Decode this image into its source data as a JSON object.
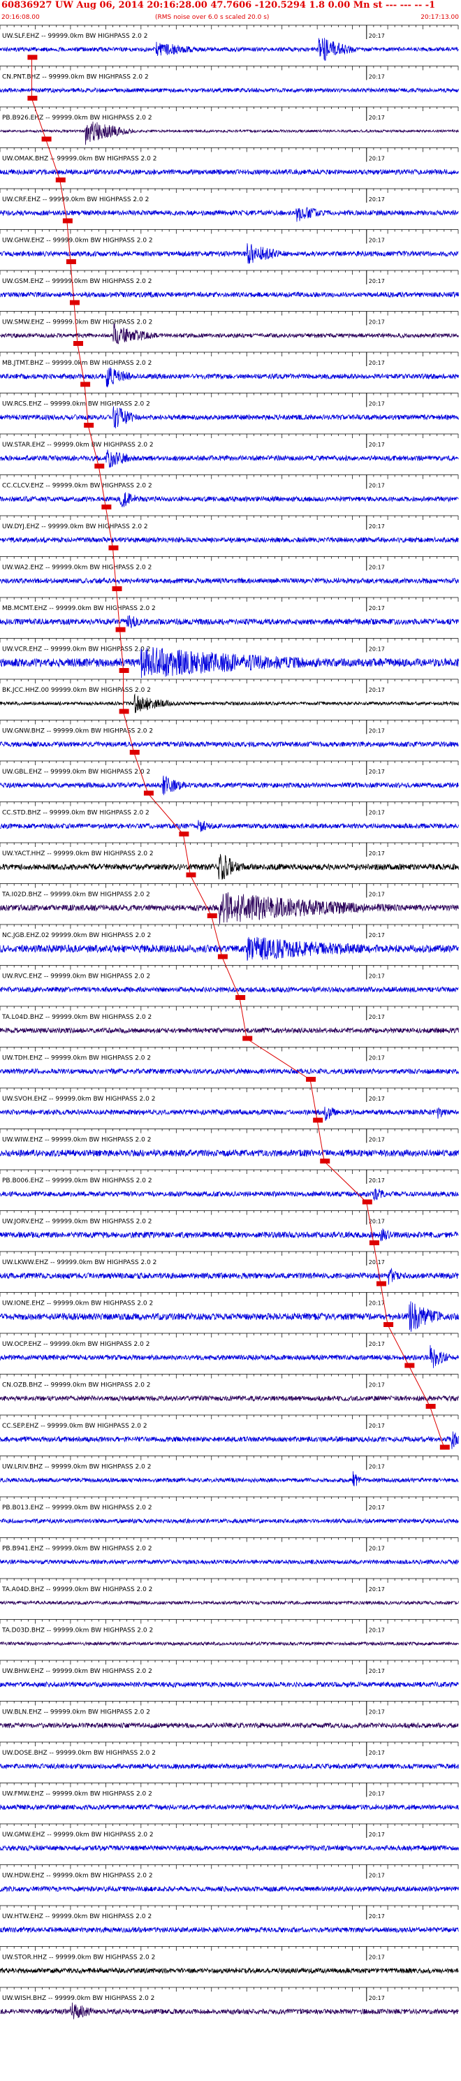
{
  "header": {
    "title": "60836927 UW Aug 06, 2014 20:16:28.00   47.7606 -120.5294  1.8 0.00 Mn st --- --- -- -1",
    "start_time": "20:16:08.00",
    "noise_note": "(RMS noise over 6.0 s scaled 20.0 s)",
    "end_time": "20:17:13.00"
  },
  "colors": {
    "trace_blue": "#0000dd",
    "trace_black": "#000000",
    "trace_purple": "#2a005a",
    "pick_red": "#dd0000",
    "minute_mark": "#000000"
  },
  "chart_data": {
    "type": "line",
    "xlim": [
      "20:16:08.00",
      "20:17:13.00"
    ],
    "minute_label": "20:17",
    "minute_mark_time_s": 52,
    "duration_s": 65,
    "traces": [
      {
        "label": "UW.SLF.EHZ -- 99999.0km BW  HIGHPASS  2.0  2",
        "pick_s": 4.5,
        "color": "blue",
        "amp": 0.25,
        "events": [
          [
            22,
            10,
            0.5
          ],
          [
            45,
            7,
            0.9
          ]
        ]
      },
      {
        "label": "CN.PNT.BHZ -- 99999.0km BW  HIGHPASS  2.0  2",
        "pick_s": 4.5,
        "color": "blue",
        "amp": 0.25,
        "events": []
      },
      {
        "label": "PB.B926.EHZ -- 99999.0km BW  HIGHPASS  2.0  2",
        "pick_s": 6.5,
        "color": "purple",
        "amp": 0.15,
        "events": [
          [
            12,
            8,
            0.9
          ]
        ]
      },
      {
        "label": "UW.OMAK.BHZ -- 99999.0km BW  HIGHPASS  2.0  2",
        "pick_s": 8.5,
        "color": "blue",
        "amp": 0.3,
        "events": []
      },
      {
        "label": "UW.CRF.EHZ -- 99999.0km BW  HIGHPASS  2.0  2",
        "pick_s": 9.5,
        "color": "blue",
        "amp": 0.3,
        "events": [
          [
            42,
            6,
            0.6
          ]
        ]
      },
      {
        "label": "UW.GHW.EHZ -- 99999.0km BW  HIGHPASS  2.0  2",
        "pick_s": 10,
        "color": "blue",
        "amp": 0.3,
        "events": [
          [
            35,
            8,
            0.7
          ]
        ]
      },
      {
        "label": "UW.GSM.EHZ -- 99999.0km BW  HIGHPASS  2.0  2",
        "pick_s": 10.5,
        "color": "blue",
        "amp": 0.3,
        "events": []
      },
      {
        "label": "UW.SMW.EHZ -- 99999.0km BW  HIGHPASS  2.0  2",
        "pick_s": 11,
        "color": "purple",
        "amp": 0.25,
        "events": [
          [
            16,
            8,
            0.8
          ]
        ]
      },
      {
        "label": "MB.JTMT.BHZ -- 99999.0km BW  HIGHPASS  2.0  2",
        "pick_s": 12,
        "color": "blue",
        "amp": 0.3,
        "events": [
          [
            15,
            6,
            0.7
          ]
        ]
      },
      {
        "label": "UW.RCS.EHZ -- 99999.0km BW  HIGHPASS  2.0  2",
        "pick_s": 12.5,
        "color": "blue",
        "amp": 0.3,
        "events": [
          [
            16,
            5,
            0.8
          ]
        ]
      },
      {
        "label": "UW.STAR.EHZ -- 99999.0km BW  HIGHPASS  2.0  2",
        "pick_s": 14,
        "color": "blue",
        "amp": 0.3,
        "events": [
          [
            15,
            6,
            0.7
          ]
        ]
      },
      {
        "label": "CC.CLCV.EHZ -- 99999.0km BW  HIGHPASS  2.0  2",
        "pick_s": 15,
        "color": "blue",
        "amp": 0.3,
        "events": [
          [
            17,
            5,
            0.6
          ]
        ]
      },
      {
        "label": "UW.DYJ.EHZ -- 99999.0km BW  HIGHPASS  2.0  2",
        "pick_s": 16,
        "color": "blue",
        "amp": 0.3,
        "events": []
      },
      {
        "label": "UW.WA2.EHZ -- 99999.0km BW  HIGHPASS  2.0  2",
        "pick_s": 16.5,
        "color": "blue",
        "amp": 0.3,
        "events": []
      },
      {
        "label": "MB.MCMT.EHZ -- 99999.0km BW  HIGHPASS  2.0  2",
        "pick_s": 17,
        "color": "blue",
        "amp": 0.35,
        "events": [
          [
            18,
            4,
            0.5
          ]
        ]
      },
      {
        "label": "UW.VCR.EHZ -- 99999.0km BW  HIGHPASS  2.0  2",
        "pick_s": 17.5,
        "color": "blue",
        "amp": 0.5,
        "events": [
          [
            20,
            40,
            1.0
          ]
        ]
      },
      {
        "label": "BK.JCC.HHZ.00 99999.0km BW  HIGHPASS  2.0  2",
        "pick_s": 17.5,
        "color": "black",
        "amp": 0.2,
        "events": [
          [
            19,
            8,
            0.6
          ]
        ]
      },
      {
        "label": "UW.GNW.BHZ -- 99999.0km BW  HIGHPASS  2.0  2",
        "pick_s": 19,
        "color": "blue",
        "amp": 0.3,
        "events": []
      },
      {
        "label": "UW.GBL.EHZ -- 99999.0km BW  HIGHPASS  2.0  2",
        "pick_s": 21,
        "color": "blue",
        "amp": 0.3,
        "events": [
          [
            23,
            5,
            0.7
          ]
        ]
      },
      {
        "label": "CC.STD.BHZ -- 99999.0km BW  HIGHPASS  2.0  2",
        "pick_s": 26,
        "color": "blue",
        "amp": 0.3,
        "events": [
          [
            28,
            4,
            0.5
          ]
        ]
      },
      {
        "label": "UW.YACT.HHZ -- 99999.0km BW  HIGHPASS  2.0  2",
        "pick_s": 27,
        "color": "black",
        "amp": 0.35,
        "events": [
          [
            31,
            5,
            1.0
          ]
        ]
      },
      {
        "label": "TA.I02D.BHZ -- 99999.0km BW  HIGHPASS  2.0  2",
        "pick_s": 30,
        "color": "purple",
        "amp": 0.35,
        "events": [
          [
            31,
            34,
            1.0
          ]
        ]
      },
      {
        "label": "NC.JGB.EHZ.02 99999.0km BW  HIGHPASS  2.0  2",
        "pick_s": 31.5,
        "color": "blue",
        "amp": 0.45,
        "events": [
          [
            35,
            30,
            0.8
          ]
        ]
      },
      {
        "label": "UW.RVC.EHZ -- 99999.0km BW  HIGHPASS  2.0  2",
        "pick_s": 34,
        "color": "blue",
        "amp": 0.3,
        "events": []
      },
      {
        "label": "TA.L04D.BHZ -- 99999.0km BW  HIGHPASS  2.0  2",
        "pick_s": 35,
        "color": "purple",
        "amp": 0.3,
        "events": []
      },
      {
        "label": "UW.TDH.EHZ -- 99999.0km BW  HIGHPASS  2.0  2",
        "pick_s": 44,
        "color": "blue",
        "amp": 0.3,
        "events": []
      },
      {
        "label": "UW.SVOH.EHZ -- 99999.0km BW  HIGHPASS  2.0  2",
        "pick_s": 45,
        "color": "blue",
        "amp": 0.3,
        "events": [
          [
            46,
            3,
            0.6
          ],
          [
            62,
            2,
            0.5
          ]
        ]
      },
      {
        "label": "UW.WIW.EHZ -- 99999.0km BW  HIGHPASS  2.0  2",
        "pick_s": 46,
        "color": "blue",
        "amp": 0.4,
        "events": []
      },
      {
        "label": "PB.B006.EHZ -- 99999.0km BW  HIGHPASS  2.0  2",
        "pick_s": 52,
        "color": "blue",
        "amp": 0.3,
        "events": [
          [
            53,
            3,
            0.5
          ]
        ]
      },
      {
        "label": "UW.JORV.EHZ -- 99999.0km BW  HIGHPASS  2.0  2",
        "pick_s": 53,
        "color": "blue",
        "amp": 0.35,
        "events": [
          [
            54,
            3,
            0.5
          ]
        ]
      },
      {
        "label": "UW.LKWW.EHZ -- 99999.0km BW  HIGHPASS  2.0  2",
        "pick_s": 54,
        "color": "blue",
        "amp": 0.35,
        "events": [
          [
            55,
            3,
            0.6
          ]
        ]
      },
      {
        "label": "UW.IONE.EHZ -- 99999.0km BW  HIGHPASS  2.0  2",
        "pick_s": 55,
        "color": "blue",
        "amp": 0.4,
        "events": [
          [
            58,
            7,
            1.0
          ]
        ]
      },
      {
        "label": "UW.OCP.EHZ -- 99999.0km BW  HIGHPASS  2.0  2",
        "pick_s": 58,
        "color": "blue",
        "amp": 0.3,
        "events": [
          [
            61,
            4,
            0.8
          ]
        ]
      },
      {
        "label": "CN.OZB.BHZ -- 99999.0km BW  HIGHPASS  2.0  2",
        "pick_s": 61,
        "color": "purple",
        "amp": 0.3,
        "events": []
      },
      {
        "label": "CC.SEP.EHZ -- 99999.0km BW  HIGHPASS  2.0  2",
        "pick_s": 63,
        "color": "blue",
        "amp": 0.3,
        "events": [
          [
            64,
            2,
            0.7
          ]
        ]
      },
      {
        "label": "UW.LRIV.BHZ -- 99999.0km BW  HIGHPASS  2.0  2",
        "pick_s": null,
        "color": "blue",
        "amp": 0.25,
        "events": [
          [
            50,
            2,
            0.6
          ]
        ]
      },
      {
        "label": "PB.B013.EHZ -- 99999.0km BW  HIGHPASS  2.0  2",
        "pick_s": null,
        "color": "blue",
        "amp": 0.25,
        "events": []
      },
      {
        "label": "PB.B941.EHZ -- 99999.0km BW  HIGHPASS  2.0  2",
        "pick_s": null,
        "color": "blue",
        "amp": 0.25,
        "events": []
      },
      {
        "label": "TA.A04D.BHZ -- 99999.0km BW  HIGHPASS  2.0  2",
        "pick_s": null,
        "color": "purple",
        "amp": 0.2,
        "events": []
      },
      {
        "label": "TA.D03D.BHZ -- 99999.0km BW  HIGHPASS  2.0  2",
        "pick_s": null,
        "color": "purple",
        "amp": 0.2,
        "events": []
      },
      {
        "label": "UW.BHW.EHZ -- 99999.0km BW  HIGHPASS  2.0  2",
        "pick_s": null,
        "color": "blue",
        "amp": 0.3,
        "events": []
      },
      {
        "label": "UW.BLN.EHZ -- 99999.0km BW  HIGHPASS  2.0  2",
        "pick_s": null,
        "color": "purple",
        "amp": 0.3,
        "events": []
      },
      {
        "label": "UW.DOSE.BHZ -- 99999.0km BW  HIGHPASS  2.0  2",
        "pick_s": null,
        "color": "blue",
        "amp": 0.3,
        "events": []
      },
      {
        "label": "UW.FMW.EHZ -- 99999.0km BW  HIGHPASS  2.0  2",
        "pick_s": null,
        "color": "blue",
        "amp": 0.3,
        "events": []
      },
      {
        "label": "UW.GMW.EHZ -- 99999.0km BW  HIGHPASS  2.0  2",
        "pick_s": null,
        "color": "blue",
        "amp": 0.3,
        "events": []
      },
      {
        "label": "UW.HDW.EHZ -- 99999.0km BW  HIGHPASS  2.0  2",
        "pick_s": null,
        "color": "blue",
        "amp": 0.3,
        "events": []
      },
      {
        "label": "UW.HTW.EHZ -- 99999.0km BW  HIGHPASS  2.0  2",
        "pick_s": null,
        "color": "blue",
        "amp": 0.3,
        "events": []
      },
      {
        "label": "UW.STOR.HHZ -- 99999.0km BW  HIGHPASS  2.0  2",
        "pick_s": null,
        "color": "black",
        "amp": 0.3,
        "events": []
      },
      {
        "label": "UW.WISH.BHZ -- 99999.0km BW  HIGHPASS  2.0  2",
        "pick_s": null,
        "color": "purple",
        "amp": 0.3,
        "events": [
          [
            10,
            6,
            0.6
          ]
        ]
      }
    ]
  }
}
